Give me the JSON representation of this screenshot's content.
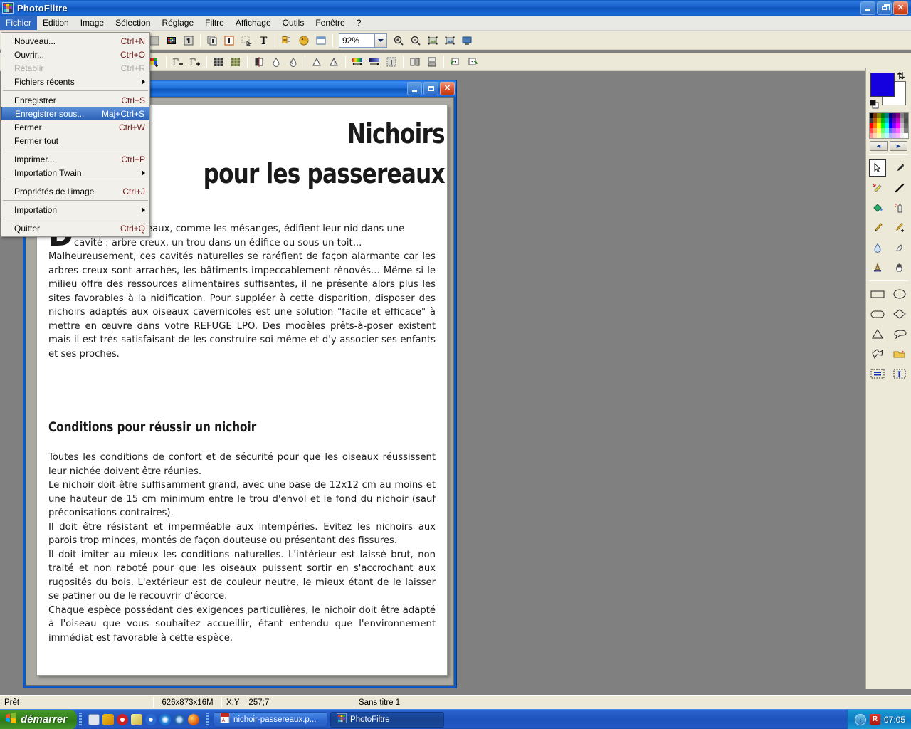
{
  "app": {
    "title": "PhotoFiltre",
    "icon": "photofiltre-icon",
    "window_buttons": {
      "minimize": "Réduire",
      "restore": "Restaurer",
      "close": "Fermer"
    }
  },
  "menubar": {
    "items": [
      {
        "label": "Fichier",
        "open": true
      },
      {
        "label": "Edition",
        "open": false
      },
      {
        "label": "Image",
        "open": false
      },
      {
        "label": "Sélection",
        "open": false
      },
      {
        "label": "Réglage",
        "open": false
      },
      {
        "label": "Filtre",
        "open": false
      },
      {
        "label": "Affichage",
        "open": false
      },
      {
        "label": "Outils",
        "open": false
      },
      {
        "label": "Fenêtre",
        "open": false
      },
      {
        "label": "?",
        "open": false
      }
    ]
  },
  "file_menu": {
    "items": [
      {
        "label": "Nouveau...",
        "shortcut": "Ctrl+N",
        "state": "normal",
        "submenu": false
      },
      {
        "label": "Ouvrir...",
        "shortcut": "Ctrl+O",
        "state": "normal",
        "submenu": false
      },
      {
        "label": "Rétablir",
        "shortcut": "Ctrl+R",
        "state": "disabled",
        "submenu": false
      },
      {
        "label": "Fichiers récents",
        "shortcut": "",
        "state": "normal",
        "submenu": true
      },
      {
        "separator": true
      },
      {
        "label": "Enregistrer",
        "shortcut": "Ctrl+S",
        "state": "normal",
        "submenu": false
      },
      {
        "label": "Enregistrer sous...",
        "shortcut": "Maj+Ctrl+S",
        "state": "selected",
        "submenu": false
      },
      {
        "label": "Fermer",
        "shortcut": "Ctrl+W",
        "state": "normal",
        "submenu": false
      },
      {
        "label": "Fermer tout",
        "shortcut": "",
        "state": "normal",
        "submenu": false
      },
      {
        "separator": true
      },
      {
        "label": "Imprimer...",
        "shortcut": "Ctrl+P",
        "state": "normal",
        "submenu": false
      },
      {
        "label": "Importation Twain",
        "shortcut": "",
        "state": "normal",
        "submenu": true
      },
      {
        "separator": true
      },
      {
        "label": "Propriétés de l'image",
        "shortcut": "Ctrl+J",
        "state": "normal",
        "submenu": false
      },
      {
        "separator": true
      },
      {
        "label": "Importation",
        "shortcut": "",
        "state": "normal",
        "submenu": true
      },
      {
        "separator": true
      },
      {
        "label": "Quitter",
        "shortcut": "Ctrl+Q",
        "state": "normal",
        "submenu": false
      }
    ]
  },
  "toolbar": {
    "zoom_value": "92%",
    "row1_icons": [
      "new-document-icon",
      "palette-icon",
      "open-image-icon",
      "copy-image-icon",
      "paste-image-icon",
      "selection-icon",
      "text-tool-icon",
      "layers-icon",
      "color-wheel-icon",
      "window-icon"
    ],
    "row1_zoom_icons": [
      "zoom-in-icon",
      "zoom-out-icon",
      "fit-width-icon",
      "fit-page-icon",
      "full-screen-icon"
    ],
    "row2_icons": [
      "add-color-icon",
      "gamma-minus-icon",
      "gamma-plus-icon",
      "grid-icon",
      "texture-icon",
      "contrast-icon",
      "blur-icon",
      "sharpen-icon",
      "lighten-icon",
      "darken-icon",
      "gradient-icon",
      "linear-gradient-icon",
      "transparency-icon",
      "flip-horizontal-icon",
      "flip-vertical-icon",
      "rotate-left-icon",
      "rotate-right-icon"
    ]
  },
  "document_window": {
    "title": "",
    "buttons": {
      "minimize": "Réduire",
      "maximize": "Agrandir",
      "close": "Fermer"
    },
    "page": {
      "title_line1": "Nichoirs",
      "title_line2": "pour les passereaux",
      "dropcap": "D",
      "intro_paragraph": "e nombreux oiseaux, comme les mésanges, édifient leur nid dans une cavité : arbre creux, un trou dans un édifice ou sous un toit...",
      "paragraph_2": "Malheureusement, ces cavités naturelles se raréfient de façon alarmante car les arbres creux sont arrachés, les bâtiments impeccablement rénovés... Même si le milieu offre des ressources alimentaires suffisantes, il ne présente alors plus les sites favorables à la nidification. Pour suppléer à cette disparition, disposer des nichoirs adaptés aux oiseaux cavernicoles est une solution \"facile et efficace\" à mettre en œuvre dans votre REFUGE LPO. Des modèles prêts-à-poser existent mais il est très satisfaisant de les construire soi-même et d'y associer ses enfants et ses proches.",
      "section_heading": "Conditions pour réussir un nichoir",
      "paragraph_3": "Toutes les conditions de confort et de sécurité pour que les oiseaux réussissent leur nichée doivent être réunies.",
      "paragraph_4": "Le nichoir doit être suffisamment grand, avec une base de 12x12 cm au moins et une hauteur de 15 cm minimum entre le trou d'envol et le fond du nichoir (sauf préconisations contraires).",
      "paragraph_5": "Il doit être résistant et imperméable aux intempéries. Evitez les nichoirs aux parois trop minces, montés de façon douteuse ou présentant des fissures.",
      "paragraph_6": "Il doit imiter au mieux les conditions naturelles. L'intérieur est laissé brut, non traité et non raboté pour que les oiseaux puissent sortir en s'accrochant aux rugosités du bois. L'extérieur est de couleur neutre, le mieux étant de le laisser se patiner ou de le recouvrir d'écorce.",
      "paragraph_7": "Chaque espèce possédant des exigences particulières, le nichoir doit être adapté à l'oiseau que vous souhaitez accueillir, étant entendu que l'environnement immédiat est favorable à cette espèce."
    }
  },
  "tool_panel": {
    "foreground_color": "#1500E0",
    "background_color": "#FFFFFF",
    "swap_icon": "swap-colors-icon",
    "default_colors_icon": "default-colors-icon",
    "prev_label": "◄",
    "next_label": "►",
    "palette_colors": [
      "#000000",
      "#7f3300",
      "#7f7f00",
      "#007f00",
      "#007f7f",
      "#00007f",
      "#3f007f",
      "#7f007f",
      "#7f7f7f",
      "#595959",
      "#3f3f3f",
      "#bf5900",
      "#bfbf00",
      "#00bf00",
      "#00bfbf",
      "#0000bf",
      "#5f00bf",
      "#bf00bf",
      "#a0a0a0",
      "#4c4c4c",
      "#ff0000",
      "#ff7f00",
      "#ffff00",
      "#00ff00",
      "#00ffff",
      "#0000ff",
      "#7f00ff",
      "#ff00ff",
      "#bfbfbf",
      "#666666",
      "#ff4c4c",
      "#ffb266",
      "#ffff66",
      "#66ff66",
      "#66ffff",
      "#6666ff",
      "#b266ff",
      "#ff66ff",
      "#d9d9d9",
      "#808080",
      "#ff9999",
      "#ffd9b2",
      "#ffffb2",
      "#b2ffb2",
      "#b2ffff",
      "#b2b2ff",
      "#d9b2ff",
      "#ffb2ff",
      "#f2f2f2",
      "#ffffff"
    ],
    "tools": [
      {
        "name": "arrow-select-icon",
        "label": "Sélection",
        "active": true
      },
      {
        "name": "eyedropper-icon",
        "label": "Pipette",
        "active": false
      },
      {
        "name": "magic-wand-icon",
        "label": "Baguette magique",
        "active": false
      },
      {
        "name": "line-tool-icon",
        "label": "Ligne",
        "active": false
      },
      {
        "name": "paint-bucket-icon",
        "label": "Pot de peinture",
        "active": false
      },
      {
        "name": "spray-can-icon",
        "label": "Aérographe",
        "active": false
      },
      {
        "name": "paintbrush-icon",
        "label": "Pinceau",
        "active": false
      },
      {
        "name": "paintbrush-advanced-icon",
        "label": "Pinceau avancé",
        "active": false
      },
      {
        "name": "water-drop-icon",
        "label": "Flou",
        "active": false
      },
      {
        "name": "smudge-icon",
        "label": "Doigt",
        "active": false
      },
      {
        "name": "stamp-icon",
        "label": "Tampon",
        "active": false
      },
      {
        "name": "hand-icon",
        "label": "Main",
        "active": false
      }
    ],
    "shapes": [
      {
        "name": "rectangle-shape-icon",
        "label": "Rectangle"
      },
      {
        "name": "ellipse-shape-icon",
        "label": "Ellipse"
      },
      {
        "name": "rounded-rectangle-shape-icon",
        "label": "Rectangle arrondi"
      },
      {
        "name": "diamond-shape-icon",
        "label": "Losange"
      },
      {
        "name": "triangle-shape-icon",
        "label": "Triangle"
      },
      {
        "name": "lasso-shape-icon",
        "label": "Lasso"
      },
      {
        "name": "polygon-shape-icon",
        "label": "Polygone"
      },
      {
        "name": "open-folder-icon",
        "label": "Ouvrir forme"
      },
      {
        "name": "horizontal-selection-icon",
        "label": "Sélection horizontale"
      },
      {
        "name": "vertical-selection-icon",
        "label": "Sélection verticale"
      }
    ]
  },
  "statusbar": {
    "status": "Prêt",
    "dimensions": "626x873x16M",
    "coordinates": "X:Y = 257;7",
    "document_name": "Sans titre 1"
  },
  "taskbar": {
    "start_label": "démarrer",
    "quick_launch": [
      "show-desktop-icon",
      "windows-media-icon",
      "opera-icon",
      "notes-icon",
      "media-player-icon",
      "internet-explorer-icon",
      "browser-icon",
      "firefox-icon"
    ],
    "tasks": [
      {
        "label": "nichoir-passereaux.p...",
        "icon": "pdf-icon",
        "active": false
      },
      {
        "label": "PhotoFiltre",
        "icon": "photofiltre-icon",
        "active": true
      }
    ],
    "tray": {
      "chevron": "‹",
      "antivirus_icon": "avira-icon",
      "clock": "07:05"
    }
  }
}
